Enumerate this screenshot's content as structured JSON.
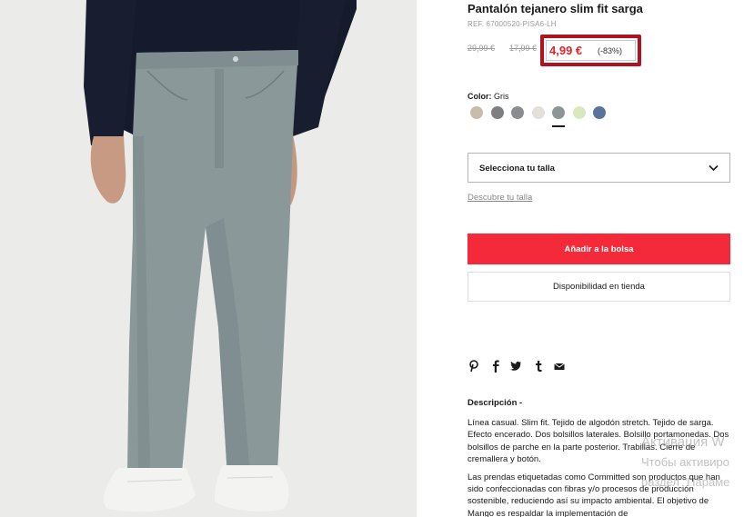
{
  "product": {
    "title": "Pantalón tejanero slim fit sarga",
    "ref": "REF. 67000520-PISA6-LH",
    "old_price_1": "29,99 €",
    "old_price_2": "17,99 €",
    "current_price": "4,99 €",
    "discount": "(-83%)"
  },
  "color": {
    "label": "Color:",
    "value": "Gris",
    "swatches": [
      {
        "name": "beige",
        "hex": "#c9bcaa"
      },
      {
        "name": "gray-dark",
        "hex": "#7d7f80"
      },
      {
        "name": "gray-mid",
        "hex": "#8a8c8e"
      },
      {
        "name": "cream",
        "hex": "#e3e0d7"
      },
      {
        "name": "gris",
        "hex": "#8d9597",
        "selected": true
      },
      {
        "name": "light-green",
        "hex": "#d9e8bf"
      },
      {
        "name": "blue",
        "hex": "#5b7398"
      }
    ]
  },
  "size": {
    "select_label": "Selecciona tu talla",
    "guide_link": "Descubre tu talla"
  },
  "actions": {
    "add_to_bag": "Añadir a la bolsa",
    "store_availability": "Disponibilidad en tienda"
  },
  "share": {
    "icons": [
      "pinterest-icon",
      "facebook-icon",
      "twitter-icon",
      "tumblr-icon",
      "email-icon"
    ]
  },
  "description": {
    "heading": "Descripción  -",
    "paragraph_1": "Línea casual. Slim fit. Tejido de algodón stretch. Tejido de sarga. Efecto encerado. Dos bolsillos laterales. Bolsillo portamonedas. Dos bolsillos de parche en la parte posterior. Trabillas. Cierre de cremallera y botón.",
    "paragraph_2": "Las prendas etiquetadas como Committed son productos que han sido confeccionadas con fibras y/o procesos de producción sostenible, reduciendo así su impacto ambiental. El objetivo de Mango es respaldar la implementación de"
  },
  "watermark": {
    "line1": "Активация W",
    "line2": "Чтобы активиро",
    "line3": "раздел \"Параме"
  },
  "colors": {
    "accent_red": "#f42a3a",
    "price_red": "#e0232e",
    "highlight_border": "#b0121f"
  }
}
